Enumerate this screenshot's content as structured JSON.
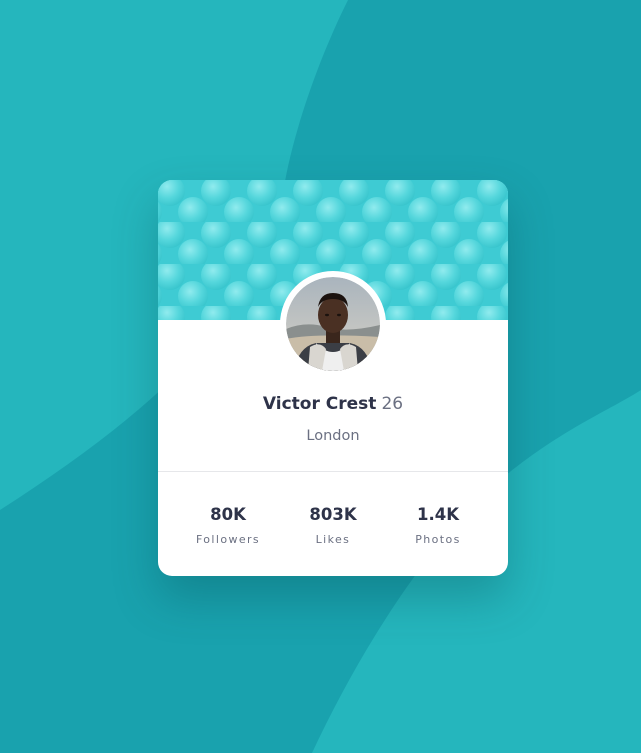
{
  "colors": {
    "background": "#19a2ae",
    "background_wave": "#25b6bd",
    "header_pattern": "#3ecbd3",
    "card": "#ffffff",
    "text_dark": "#2e3349",
    "text_muted": "#6b7082"
  },
  "profile": {
    "name": "Victor Crest",
    "age": "26",
    "city": "London"
  },
  "stats": [
    {
      "value": "80K",
      "label": "Followers"
    },
    {
      "value": "803K",
      "label": "Likes"
    },
    {
      "value": "1.4K",
      "label": "Photos"
    }
  ]
}
